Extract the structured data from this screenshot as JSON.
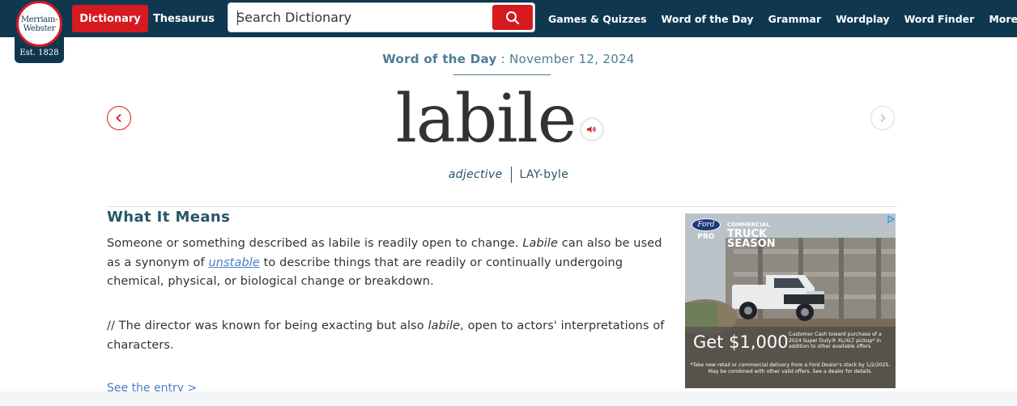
{
  "header": {
    "logo": {
      "line1": "Merriam-",
      "line2": "Webster",
      "est": "Est. 1828"
    },
    "buttons": {
      "dictionary": "Dictionary",
      "thesaurus": "Thesaurus"
    },
    "search": {
      "placeholder": "Search Dictionary"
    },
    "nav": [
      "Games & Quizzes",
      "Word of the Day",
      "Grammar",
      "Wordplay",
      "Word Finder",
      "More"
    ]
  },
  "wotd": {
    "label": "Word of the Day",
    "separator": " : ",
    "date": "November 12, 2024",
    "word": "labile",
    "part_of_speech": "adjective",
    "pronunciation": "LAY-byle"
  },
  "content": {
    "heading": "What It Means",
    "p1_a": "Someone or something described as labile is readily open to change. ",
    "p1_em": "Labile",
    "p1_b": " can also be used as a synonym of ",
    "p1_link": "unstable",
    "p1_c": " to describe things that are readily or continually undergoing chemical, physical, or biological change or breakdown.",
    "p2_a": "// The director was known for being exacting but also ",
    "p2_em": "labile",
    "p2_b": ", open to actors' interpretations of characters.",
    "see_entry": "See the entry >"
  },
  "ad": {
    "brand": "Ford",
    "brand_sub": "PRO",
    "title_small": "COMMERCIAL",
    "title_line1": "TRUCK",
    "title_line2": "SEASON",
    "offer": "Get $1,000",
    "fine1": "Customer Cash toward purchase of a 2024 Super Duty® XL/XLT pickup* in addition to other available offers",
    "fine2": "*Take new retail or commercial delivery from a Ford Dealer's stock by 1/2/2025. May be combined with other valid offers. See a dealer for details.",
    "colors": {
      "sky": "#b9c3c9",
      "ground": "#7b6a55",
      "truck": "#e9ebec"
    }
  },
  "colors": {
    "navy": "#0f3850",
    "red": "#d71920",
    "teal": "#265667",
    "link": "#4a7ec6"
  }
}
